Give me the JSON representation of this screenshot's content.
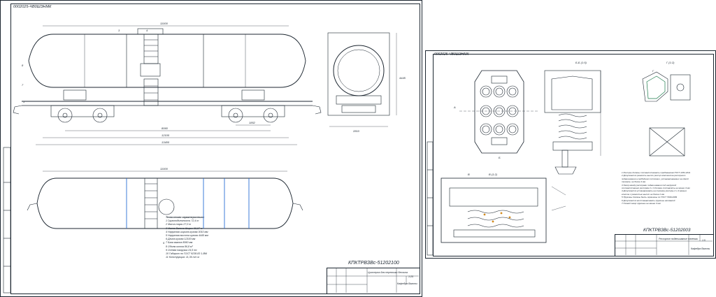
{
  "sheet1": {
    "stamp_top": "0002025-ЧВ0ШЭНМК",
    "drawing_code": "КПКТРВЗВс-51202100",
    "tech_title": "Техническая характеристика:",
    "tech_items": [
      "1 Грузоподъемность 72,4 т",
      "2 Масса тары 27,0 т",
      "3 Масса Валика Ширин 99,97 м",
      "4 Наружная ширина кузова 3010 мм",
      "5 Наружная высота кузова 4445 мм",
      "6 Длина кузова 12100 мм",
      "7 База вагона 8060 мм",
      "8 Объем котла 86,8 м³",
      "9 Осевая нагрузка 24,5 тс",
      "10 Габарит по ГОСТ 9238-83 1-ВМ",
      "11 Конструкция: 11,36 т/с м"
    ],
    "tb_name": "Цистерна для перевозки бензина",
    "tb_group": "Кафедра Вагоны",
    "tb_scale": "1:25",
    "tb_sheet": "1:25",
    "dims": [
      "11000",
      "8060",
      "12100",
      "13400",
      "1852",
      "2810",
      "4445",
      "3010",
      "11000"
    ],
    "labels": [
      "1",
      "2",
      "3",
      "4",
      "5",
      "6",
      "7",
      "8"
    ]
  },
  "sheet2": {
    "stamp_top": "0002025-ЧВ0ШЭНМК",
    "drawing_code": "КПКТРВЗВс-51202003",
    "view_labels": [
      "A (1:2)",
      "Б-Б (1:5)",
      "В (1:2)",
      "Г (1:2)",
      "А",
      "Б",
      "В",
      "Г"
    ],
    "notes": [
      "1 Рессоры должны соответствовать требованиям ГОСТ 1452-2011",
      "2 Допускается разность высот рессор комплектов рессорного",
      "подвешивания в свободном состоянии, устанавливаемых на одной",
      "тележке, не более 4 мм",
      "3 Зазор между рессорами подвешивания под нагрузкой",
      "соответственно рессорам 2 и 3 должен составлять не менее 3 мм",
      "4 Допускается устанавливать на тележку рессоры 2 и 3 разных",
      "классов с разностью высот не более 2 мм",
      "5 Пружины должны быть окрашены по ГОСТ 7409-2009",
      "6 Допускается восстанавливать пружины наплавкой",
      "7 Осевой зазор пружины не менее 3 мм"
    ],
    "tb_name": "Рессорное подвешивание тележки",
    "tb_group": "Кафедра Вагоны",
    "tb_scale": "1:5"
  },
  "colors": {
    "line": "#1c2630",
    "accent": "#2a6fd6",
    "paper": "#ffffff"
  }
}
